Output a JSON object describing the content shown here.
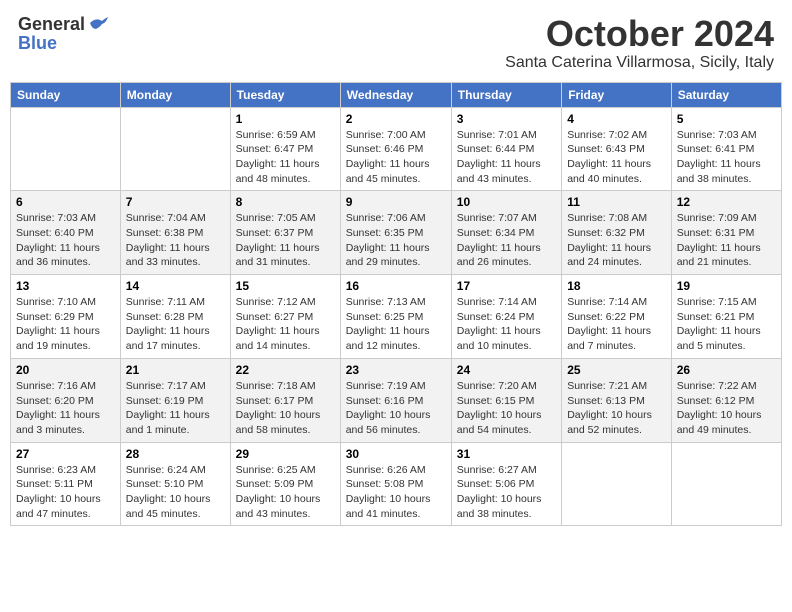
{
  "header": {
    "logo_general": "General",
    "logo_blue": "Blue",
    "month_title": "October 2024",
    "subtitle": "Santa Caterina Villarmosa, Sicily, Italy"
  },
  "days_of_week": [
    "Sunday",
    "Monday",
    "Tuesday",
    "Wednesday",
    "Thursday",
    "Friday",
    "Saturday"
  ],
  "weeks": [
    [
      {
        "num": "",
        "info": ""
      },
      {
        "num": "",
        "info": ""
      },
      {
        "num": "1",
        "info": "Sunrise: 6:59 AM\nSunset: 6:47 PM\nDaylight: 11 hours and 48 minutes."
      },
      {
        "num": "2",
        "info": "Sunrise: 7:00 AM\nSunset: 6:46 PM\nDaylight: 11 hours and 45 minutes."
      },
      {
        "num": "3",
        "info": "Sunrise: 7:01 AM\nSunset: 6:44 PM\nDaylight: 11 hours and 43 minutes."
      },
      {
        "num": "4",
        "info": "Sunrise: 7:02 AM\nSunset: 6:43 PM\nDaylight: 11 hours and 40 minutes."
      },
      {
        "num": "5",
        "info": "Sunrise: 7:03 AM\nSunset: 6:41 PM\nDaylight: 11 hours and 38 minutes."
      }
    ],
    [
      {
        "num": "6",
        "info": "Sunrise: 7:03 AM\nSunset: 6:40 PM\nDaylight: 11 hours and 36 minutes."
      },
      {
        "num": "7",
        "info": "Sunrise: 7:04 AM\nSunset: 6:38 PM\nDaylight: 11 hours and 33 minutes."
      },
      {
        "num": "8",
        "info": "Sunrise: 7:05 AM\nSunset: 6:37 PM\nDaylight: 11 hours and 31 minutes."
      },
      {
        "num": "9",
        "info": "Sunrise: 7:06 AM\nSunset: 6:35 PM\nDaylight: 11 hours and 29 minutes."
      },
      {
        "num": "10",
        "info": "Sunrise: 7:07 AM\nSunset: 6:34 PM\nDaylight: 11 hours and 26 minutes."
      },
      {
        "num": "11",
        "info": "Sunrise: 7:08 AM\nSunset: 6:32 PM\nDaylight: 11 hours and 24 minutes."
      },
      {
        "num": "12",
        "info": "Sunrise: 7:09 AM\nSunset: 6:31 PM\nDaylight: 11 hours and 21 minutes."
      }
    ],
    [
      {
        "num": "13",
        "info": "Sunrise: 7:10 AM\nSunset: 6:29 PM\nDaylight: 11 hours and 19 minutes."
      },
      {
        "num": "14",
        "info": "Sunrise: 7:11 AM\nSunset: 6:28 PM\nDaylight: 11 hours and 17 minutes."
      },
      {
        "num": "15",
        "info": "Sunrise: 7:12 AM\nSunset: 6:27 PM\nDaylight: 11 hours and 14 minutes."
      },
      {
        "num": "16",
        "info": "Sunrise: 7:13 AM\nSunset: 6:25 PM\nDaylight: 11 hours and 12 minutes."
      },
      {
        "num": "17",
        "info": "Sunrise: 7:14 AM\nSunset: 6:24 PM\nDaylight: 11 hours and 10 minutes."
      },
      {
        "num": "18",
        "info": "Sunrise: 7:14 AM\nSunset: 6:22 PM\nDaylight: 11 hours and 7 minutes."
      },
      {
        "num": "19",
        "info": "Sunrise: 7:15 AM\nSunset: 6:21 PM\nDaylight: 11 hours and 5 minutes."
      }
    ],
    [
      {
        "num": "20",
        "info": "Sunrise: 7:16 AM\nSunset: 6:20 PM\nDaylight: 11 hours and 3 minutes."
      },
      {
        "num": "21",
        "info": "Sunrise: 7:17 AM\nSunset: 6:19 PM\nDaylight: 11 hours and 1 minute."
      },
      {
        "num": "22",
        "info": "Sunrise: 7:18 AM\nSunset: 6:17 PM\nDaylight: 10 hours and 58 minutes."
      },
      {
        "num": "23",
        "info": "Sunrise: 7:19 AM\nSunset: 6:16 PM\nDaylight: 10 hours and 56 minutes."
      },
      {
        "num": "24",
        "info": "Sunrise: 7:20 AM\nSunset: 6:15 PM\nDaylight: 10 hours and 54 minutes."
      },
      {
        "num": "25",
        "info": "Sunrise: 7:21 AM\nSunset: 6:13 PM\nDaylight: 10 hours and 52 minutes."
      },
      {
        "num": "26",
        "info": "Sunrise: 7:22 AM\nSunset: 6:12 PM\nDaylight: 10 hours and 49 minutes."
      }
    ],
    [
      {
        "num": "27",
        "info": "Sunrise: 6:23 AM\nSunset: 5:11 PM\nDaylight: 10 hours and 47 minutes."
      },
      {
        "num": "28",
        "info": "Sunrise: 6:24 AM\nSunset: 5:10 PM\nDaylight: 10 hours and 45 minutes."
      },
      {
        "num": "29",
        "info": "Sunrise: 6:25 AM\nSunset: 5:09 PM\nDaylight: 10 hours and 43 minutes."
      },
      {
        "num": "30",
        "info": "Sunrise: 6:26 AM\nSunset: 5:08 PM\nDaylight: 10 hours and 41 minutes."
      },
      {
        "num": "31",
        "info": "Sunrise: 6:27 AM\nSunset: 5:06 PM\nDaylight: 10 hours and 38 minutes."
      },
      {
        "num": "",
        "info": ""
      },
      {
        "num": "",
        "info": ""
      }
    ]
  ]
}
